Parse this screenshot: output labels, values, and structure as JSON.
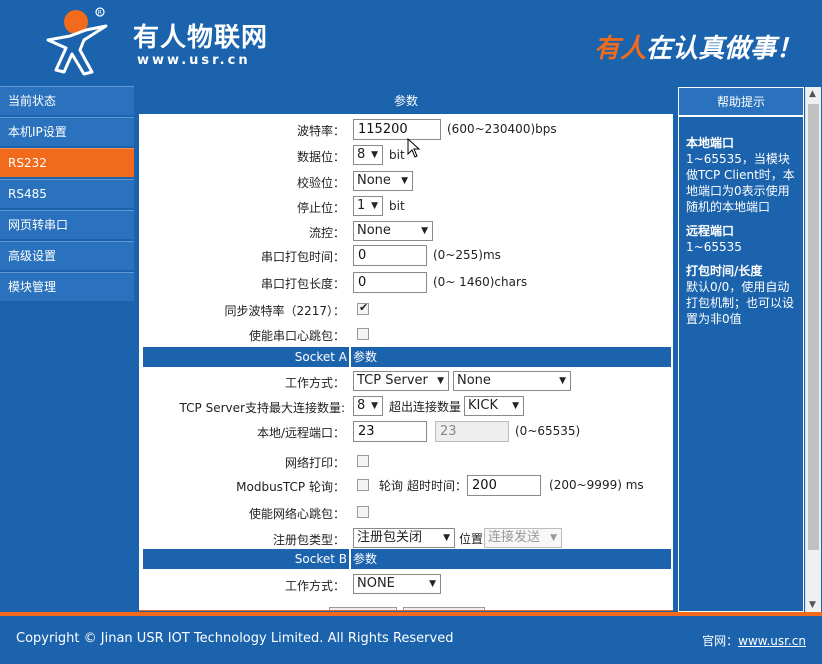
{
  "header": {
    "brand_name": "有人物联网",
    "brand_url": "www.usr.cn",
    "slogan_highlight": "有人",
    "slogan_rest": "在认真做事！",
    "accent_color": "#f26a1b",
    "brand_color": "#1b63ad"
  },
  "sidebar": {
    "items": [
      {
        "label": "当前状态"
      },
      {
        "label": "本机IP设置"
      },
      {
        "label": "RS232"
      },
      {
        "label": "RS485"
      },
      {
        "label": "网页转串口"
      },
      {
        "label": "高级设置"
      },
      {
        "label": "模块管理"
      }
    ],
    "active_index": 2
  },
  "main": {
    "title": "参数",
    "baud": {
      "label": "波特率：",
      "value": "115200",
      "hint": "(600~230400)bps"
    },
    "databits": {
      "label": "数据位：",
      "value": "8",
      "unit": "bit"
    },
    "parity": {
      "label": "校验位：",
      "value": "None"
    },
    "stopbits": {
      "label": "停止位：",
      "value": "1",
      "unit": "bit"
    },
    "flow": {
      "label": "流控：",
      "value": "None"
    },
    "pack_time": {
      "label": "串口打包时间：",
      "value": "0",
      "hint": "(0~255)ms"
    },
    "pack_len": {
      "label": "串口打包长度：",
      "value": "0",
      "hint": "(0~ 1460)chars"
    },
    "sync_baud": {
      "label": "同步波特率（2217）：",
      "checked": true
    },
    "serial_heartbeat": {
      "label": "使能串口心跳包：",
      "checked": false
    },
    "socket_a": {
      "title": "Socket A",
      "sub": "参数",
      "mode": {
        "label": "工作方式：",
        "value": "TCP Server",
        "value2": "None"
      },
      "max_conn": {
        "label": "TCP Server支持最大连接数量:",
        "value": "8",
        "overflow_label": "超出连接数量",
        "overflow_value": "KICK"
      },
      "ports": {
        "label": "本地/远程端口：",
        "local": "23",
        "remote": "23",
        "hint": "(0~65535)"
      },
      "net_print": {
        "label": "网络打印：",
        "checked": false
      },
      "modbus": {
        "label": "ModbusTCP 轮询：",
        "checked": false,
        "poll_label": "轮询",
        "timeout_label": "超时时间：",
        "timeout_value": "200",
        "hint": "(200~9999) ms"
      },
      "net_heartbeat": {
        "label": "使能网络心跳包：",
        "checked": false
      },
      "reg_type": {
        "label": "注册包类型：",
        "value": "注册包关闭",
        "pos_label": "位置",
        "pos_value": "连接发送"
      }
    },
    "socket_b": {
      "title": "Socket B",
      "sub": "参数",
      "mode": {
        "label": "工作方式：",
        "value": "NONE"
      }
    }
  },
  "help": {
    "title": "帮助提示",
    "sections": [
      {
        "title": "本地端口",
        "text": "1~65535，当模块做TCP Client时，本地端口为0表示使用随机的本地端口"
      },
      {
        "title": "远程端口",
        "text": "1~65535"
      },
      {
        "title": "打包时间/长度",
        "text": "默认0/0，使用自动打包机制；也可以设置为非0值"
      }
    ]
  },
  "footer": {
    "copyright": "Copyright © Jinan USR IOT Technology Limited. All Rights Reserved",
    "site_label": "官网：",
    "site_link": "www.usr.cn"
  }
}
